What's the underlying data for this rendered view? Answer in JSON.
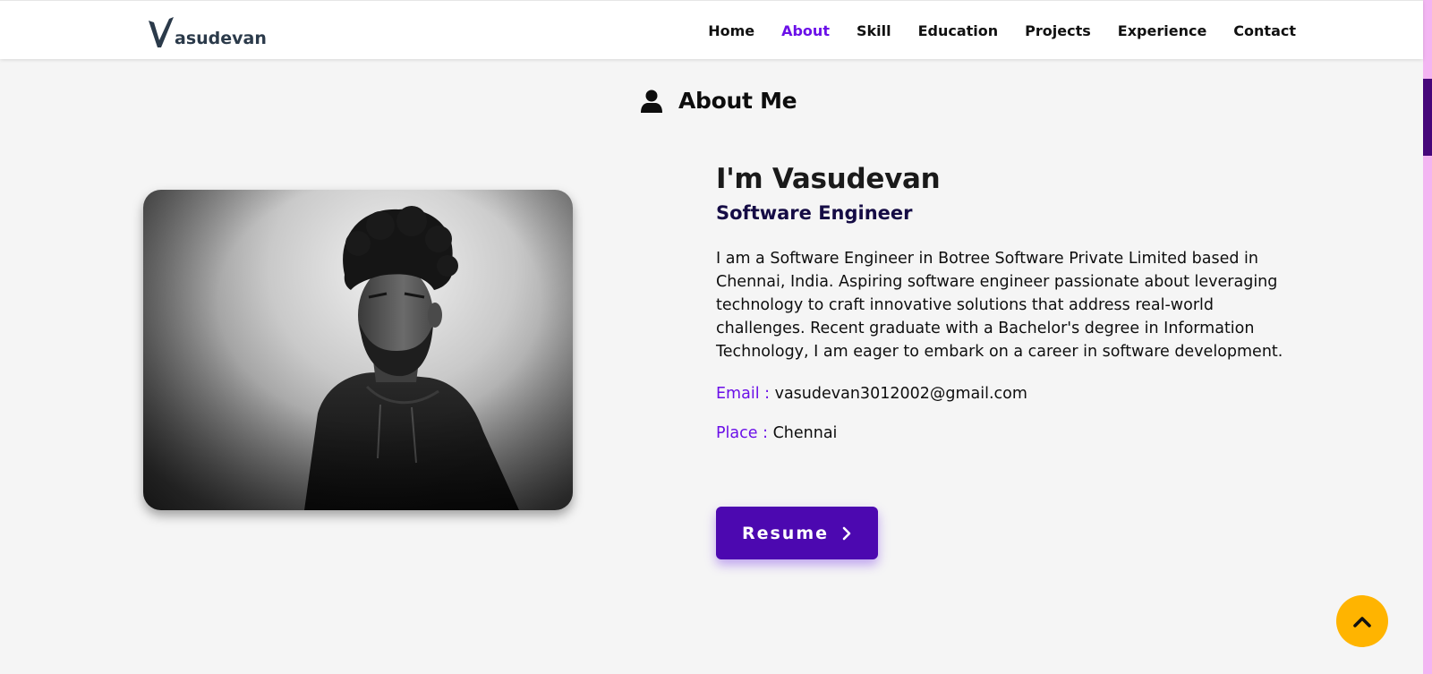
{
  "brand": {
    "logo_text": "asudevan",
    "logo_letter": "V"
  },
  "nav": {
    "items": [
      {
        "label": "Home"
      },
      {
        "label": "About",
        "active": true
      },
      {
        "label": "Skill"
      },
      {
        "label": "Education"
      },
      {
        "label": "Projects"
      },
      {
        "label": "Experience"
      },
      {
        "label": "Contact"
      }
    ]
  },
  "section": {
    "title": "About Me",
    "icon": "user-icon"
  },
  "about": {
    "name": "I'm Vasudevan",
    "role": "Software Engineer",
    "bio": "I am a Software Engineer in Botree Software Private Limited based in Chennai, India. Aspiring software engineer passionate about leveraging technology to craft innovative solutions that address real-world challenges. Recent graduate with a Bachelor's degree in Information Technology, I am eager to embark on a career in software development.",
    "email_label": "Email :",
    "email_value": "vasudevan3012002@gmail.com",
    "place_label": "Place :",
    "place_value": "Chennai",
    "resume_label": "Resume"
  },
  "colors": {
    "accent": "#6b10e8",
    "button": "#4c08b0",
    "scroll_top": "#ffb400",
    "scrollbar_track": "#f3b4f1",
    "scrollbar_thumb": "#46077a"
  }
}
